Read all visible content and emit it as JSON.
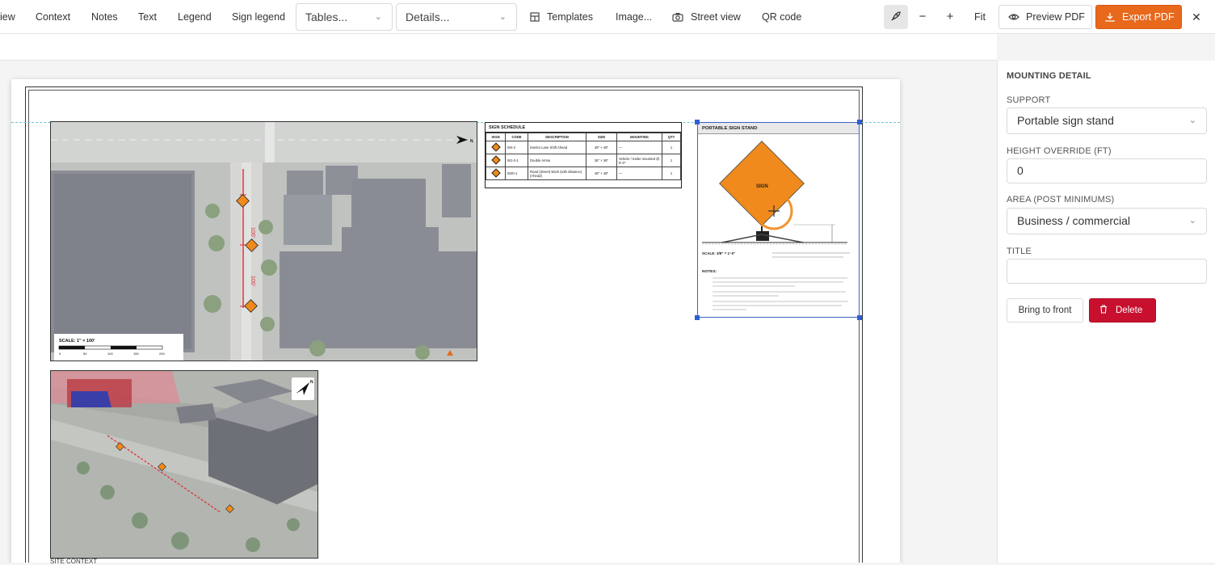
{
  "toolbar": {
    "view_label": "iew",
    "context_label": "Context",
    "notes_label": "Notes",
    "text_label": "Text",
    "legend_label": "Legend",
    "sign_legend_label": "Sign legend",
    "tables_value": "Tables...",
    "details_value": "Details...",
    "templates_label": "Templates",
    "image_label": "Image...",
    "street_view_label": "Street view",
    "qr_code_label": "QR code",
    "zoom_out_label": "−",
    "zoom_in_label": "+",
    "fit_label": "Fit",
    "preview_label": "Preview PDF",
    "export_label": "Export PDF",
    "close_label": "✕",
    "accent_color": "#e8681c"
  },
  "sheet": {
    "map1_scale_label": "SCALE: 1\" = 100'",
    "map1_scale_ticks": [
      "0",
      "50",
      "100",
      "150",
      "200"
    ],
    "map_labels": [
      "100'",
      "100'"
    ],
    "north_label": "N",
    "caption_text": "SITE CONTEXT",
    "sign_schedule": {
      "title": "SIGN SCHEDULE",
      "columns": [
        "SIGN",
        "CODE",
        "DESCRIPTION",
        "SIZE",
        "MOUNTING",
        "QTY"
      ],
      "rows": [
        {
          "code": "W4-2",
          "description": "Interior Lane Shift Ahead",
          "size": "48\" × 48\"",
          "mounting": "—",
          "qty": "1"
        },
        {
          "code": "W1-3-1",
          "description": "Double Arrow",
          "size": "36\" × 36\"",
          "mounting": "Vehicle / trailer mounted @ 5'-0\"",
          "qty": "1"
        },
        {
          "code": "W20-1",
          "description": "Road (Street) Work (with distance) (Ahead)",
          "size": "48\" × 48\"",
          "mounting": "—",
          "qty": "1"
        }
      ]
    },
    "portable_stand": {
      "title": "PORTABLE SIGN STAND",
      "sign_text": "SIGN",
      "scale_text": "SCALE: 3/8\" = 1'-0\"",
      "notes_heading": "NOTES:",
      "sign_color": "#f08a1c"
    }
  },
  "panel": {
    "heading": "MOUNTING DETAIL",
    "support_label": "SUPPORT",
    "support_value": "Portable sign stand",
    "height_label": "HEIGHT OVERRIDE (FT)",
    "height_value": "0",
    "area_label": "AREA (POST MINIMUMS)",
    "area_value": "Business / commercial",
    "title_label": "TITLE",
    "title_value": "",
    "bring_front_label": "Bring to front",
    "delete_label": "Delete",
    "delete_color": "#c8102e"
  }
}
